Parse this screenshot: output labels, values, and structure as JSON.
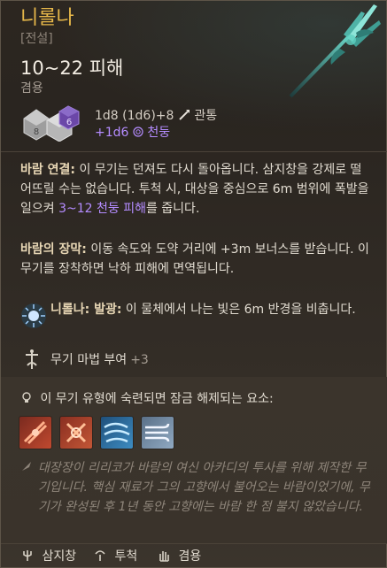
{
  "item": {
    "name": "니롤나",
    "rarity": "[전설]",
    "damage": "10~22 피해",
    "weapon_property": "겸용",
    "dice_line": "1d8 (1d6)+8",
    "damage_type": "관통",
    "extra_dice": "+1d6",
    "extra_type": "천둥",
    "dice_faces": [
      "8",
      "6"
    ]
  },
  "abilities": [
    {
      "title": "바람 연결:",
      "text_before": " 이 무기는 던져도 다시 돌아옵니다. 삼지창을 강제로 떨어뜨릴 수는 없습니다. 투척 시, 대상을 중심으로 6m 범위에 폭발을 일으켜 ",
      "highlight": "3~12 천둥 피해",
      "text_after": "를 줍니다."
    },
    {
      "title": "바람의 장막:",
      "text": " 이동 속도와 도약 거리에 +3m 보너스를 받습니다. 이 무기를 장착하면 낙하 피해에 면역됩니다."
    }
  ],
  "feature": {
    "title": "니롤나: 발광:",
    "text": " 이 물체에서 나는 빛은 6m 반경을 비춥니다."
  },
  "enchant": {
    "label": "무기 마법 부여",
    "bonus": "+3"
  },
  "mastery": {
    "title": "이 무기 유형에 숙련되면 잠금 해제되는 요소:",
    "actions": [
      "action-1",
      "action-2",
      "action-3",
      "action-4"
    ]
  },
  "lore": "대장장이 리리코가 바람의 여신 아카디의 투사를 위해 제작한 무기입니다. 핵심 재료가 그의 고향에서 불어오는 바람이었기에, 무기가 완성된 후 1년 동안 고향에는 바람 한 점 불지 않았습니다.",
  "properties": [
    {
      "label": "삼지창",
      "icon": "trident-icon"
    },
    {
      "label": "투척",
      "icon": "throw-icon"
    },
    {
      "label": "겸용",
      "icon": "hand-icon"
    }
  ],
  "colors": {
    "name": "#e7b84a",
    "accent_purple": "#b48cff",
    "bold_text": "#e8d7b5"
  }
}
